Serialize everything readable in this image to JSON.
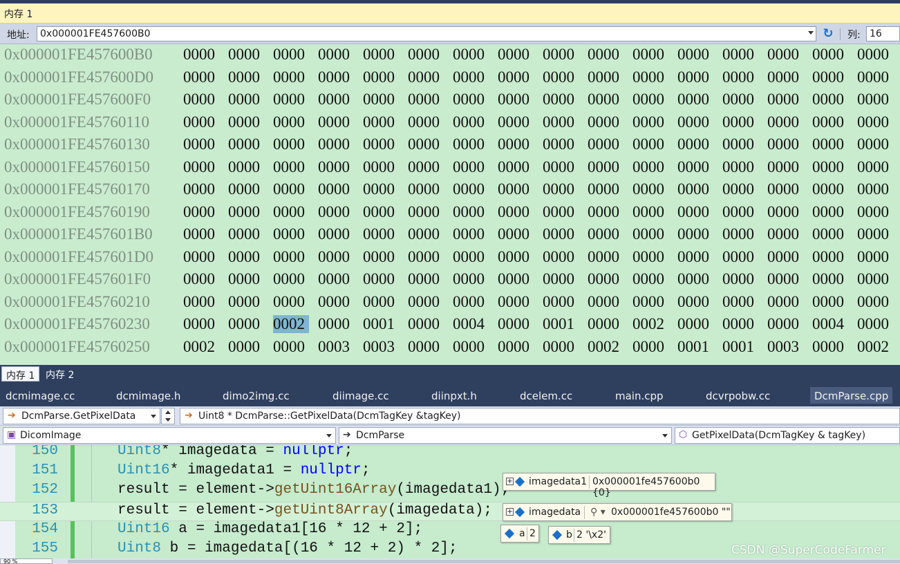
{
  "window": {
    "title": "内存 1"
  },
  "address_bar": {
    "label": "地址:",
    "value": "0x000001FE457600B0",
    "columns_label": "列:",
    "columns_value": "16"
  },
  "memory": {
    "rows": [
      {
        "addr": "0x000001FE457600B0",
        "words": [
          "0000",
          "0000",
          "0000",
          "0000",
          "0000",
          "0000",
          "0000",
          "0000",
          "0000",
          "0000",
          "0000",
          "0000",
          "0000",
          "0000",
          "0000",
          "0000"
        ]
      },
      {
        "addr": "0x000001FE457600D0",
        "words": [
          "0000",
          "0000",
          "0000",
          "0000",
          "0000",
          "0000",
          "0000",
          "0000",
          "0000",
          "0000",
          "0000",
          "0000",
          "0000",
          "0000",
          "0000",
          "0000"
        ]
      },
      {
        "addr": "0x000001FE457600F0",
        "words": [
          "0000",
          "0000",
          "0000",
          "0000",
          "0000",
          "0000",
          "0000",
          "0000",
          "0000",
          "0000",
          "0000",
          "0000",
          "0000",
          "0000",
          "0000",
          "0000"
        ]
      },
      {
        "addr": "0x000001FE45760110",
        "words": [
          "0000",
          "0000",
          "0000",
          "0000",
          "0000",
          "0000",
          "0000",
          "0000",
          "0000",
          "0000",
          "0000",
          "0000",
          "0000",
          "0000",
          "0000",
          "0000"
        ]
      },
      {
        "addr": "0x000001FE45760130",
        "words": [
          "0000",
          "0000",
          "0000",
          "0000",
          "0000",
          "0000",
          "0000",
          "0000",
          "0000",
          "0000",
          "0000",
          "0000",
          "0000",
          "0000",
          "0000",
          "0000"
        ]
      },
      {
        "addr": "0x000001FE45760150",
        "words": [
          "0000",
          "0000",
          "0000",
          "0000",
          "0000",
          "0000",
          "0000",
          "0000",
          "0000",
          "0000",
          "0000",
          "0000",
          "0000",
          "0000",
          "0000",
          "0000"
        ]
      },
      {
        "addr": "0x000001FE45760170",
        "words": [
          "0000",
          "0000",
          "0000",
          "0000",
          "0000",
          "0000",
          "0000",
          "0000",
          "0000",
          "0000",
          "0000",
          "0000",
          "0000",
          "0000",
          "0000",
          "0000"
        ]
      },
      {
        "addr": "0x000001FE45760190",
        "words": [
          "0000",
          "0000",
          "0000",
          "0000",
          "0000",
          "0000",
          "0000",
          "0000",
          "0000",
          "0000",
          "0000",
          "0000",
          "0000",
          "0000",
          "0000",
          "0000"
        ]
      },
      {
        "addr": "0x000001FE457601B0",
        "words": [
          "0000",
          "0000",
          "0000",
          "0000",
          "0000",
          "0000",
          "0000",
          "0000",
          "0000",
          "0000",
          "0000",
          "0000",
          "0000",
          "0000",
          "0000",
          "0000"
        ]
      },
      {
        "addr": "0x000001FE457601D0",
        "words": [
          "0000",
          "0000",
          "0000",
          "0000",
          "0000",
          "0000",
          "0000",
          "0000",
          "0000",
          "0000",
          "0000",
          "0000",
          "0000",
          "0000",
          "0000",
          "0000"
        ]
      },
      {
        "addr": "0x000001FE457601F0",
        "words": [
          "0000",
          "0000",
          "0000",
          "0000",
          "0000",
          "0000",
          "0000",
          "0000",
          "0000",
          "0000",
          "0000",
          "0000",
          "0000",
          "0000",
          "0000",
          "0000"
        ]
      },
      {
        "addr": "0x000001FE45760210",
        "words": [
          "0000",
          "0000",
          "0000",
          "0000",
          "0000",
          "0000",
          "0000",
          "0000",
          "0000",
          "0000",
          "0000",
          "0000",
          "0000",
          "0000",
          "0000",
          "0000"
        ]
      },
      {
        "addr": "0x000001FE45760230",
        "words": [
          "0000",
          "0000",
          "0002",
          "0000",
          "0001",
          "0000",
          "0004",
          "0000",
          "0001",
          "0000",
          "0002",
          "0000",
          "0000",
          "0000",
          "0004",
          "0000"
        ]
      },
      {
        "addr": "0x000001FE45760250",
        "words": [
          "0002",
          "0000",
          "0000",
          "0003",
          "0003",
          "0000",
          "0000",
          "0000",
          "0000",
          "0002",
          "0000",
          "0001",
          "0001",
          "0003",
          "0000",
          "0002"
        ]
      }
    ],
    "selected": {
      "row": 12,
      "col": 2
    }
  },
  "memory_tabs": [
    {
      "label": "内存 1"
    },
    {
      "label": "内存 2"
    }
  ],
  "file_tabs": [
    {
      "label": "dcmimage.cc"
    },
    {
      "label": "dcmimage.h"
    },
    {
      "label": "dimo2img.cc"
    },
    {
      "label": "diimage.cc"
    },
    {
      "label": "diinpxt.h"
    },
    {
      "label": "dcelem.cc"
    },
    {
      "label": "main.cpp"
    },
    {
      "label": "dcvrpobw.cc"
    },
    {
      "label": "DcmParse.cpp"
    }
  ],
  "navigation": {
    "stack_frame": "DcmParse.GetPixelData",
    "function_signature": "Uint8 * DcmParse::GetPixelData(DcmTagKey &tagKey)",
    "project": "DicomImage",
    "class_scope": "DcmParse",
    "member": "GetPixelData(DcmTagKey & tagKey)"
  },
  "code": {
    "lines": [
      {
        "num": "150",
        "text": "Uint8* imagedata = nullptr;"
      },
      {
        "num": "151",
        "text": "Uint16* imagedata1 = nullptr;"
      },
      {
        "num": "152",
        "text": "result = element->getUint16Array(imagedata1);"
      },
      {
        "num": "153",
        "text": "result = element->getUint8Array(imagedata);"
      },
      {
        "num": "154",
        "text": "Uint16 a = imagedata1[16 * 12 + 2];"
      },
      {
        "num": "155",
        "text": "Uint8 b = imagedata[(16 * 12 + 2) * 2];"
      }
    ],
    "current_line": "153"
  },
  "datatips": {
    "imagedata1": {
      "name": "imagedata1",
      "value": "0x000001fe457600b0 {0}"
    },
    "imagedata": {
      "name": "imagedata",
      "value": "0x000001fe457600b0 \"\""
    },
    "a": {
      "name": "a",
      "value": "2"
    },
    "b": {
      "name": "b",
      "value": "2 '\\x2'"
    }
  },
  "watermark": "CSDN @SuperCodeFarmer",
  "zoom": "90 %",
  "colors": {
    "memory_bg": "#c9ecce",
    "code_bg": "#c6ebcd",
    "tab_bar": "#2f3f5e",
    "selection": "#7fb6cf"
  }
}
